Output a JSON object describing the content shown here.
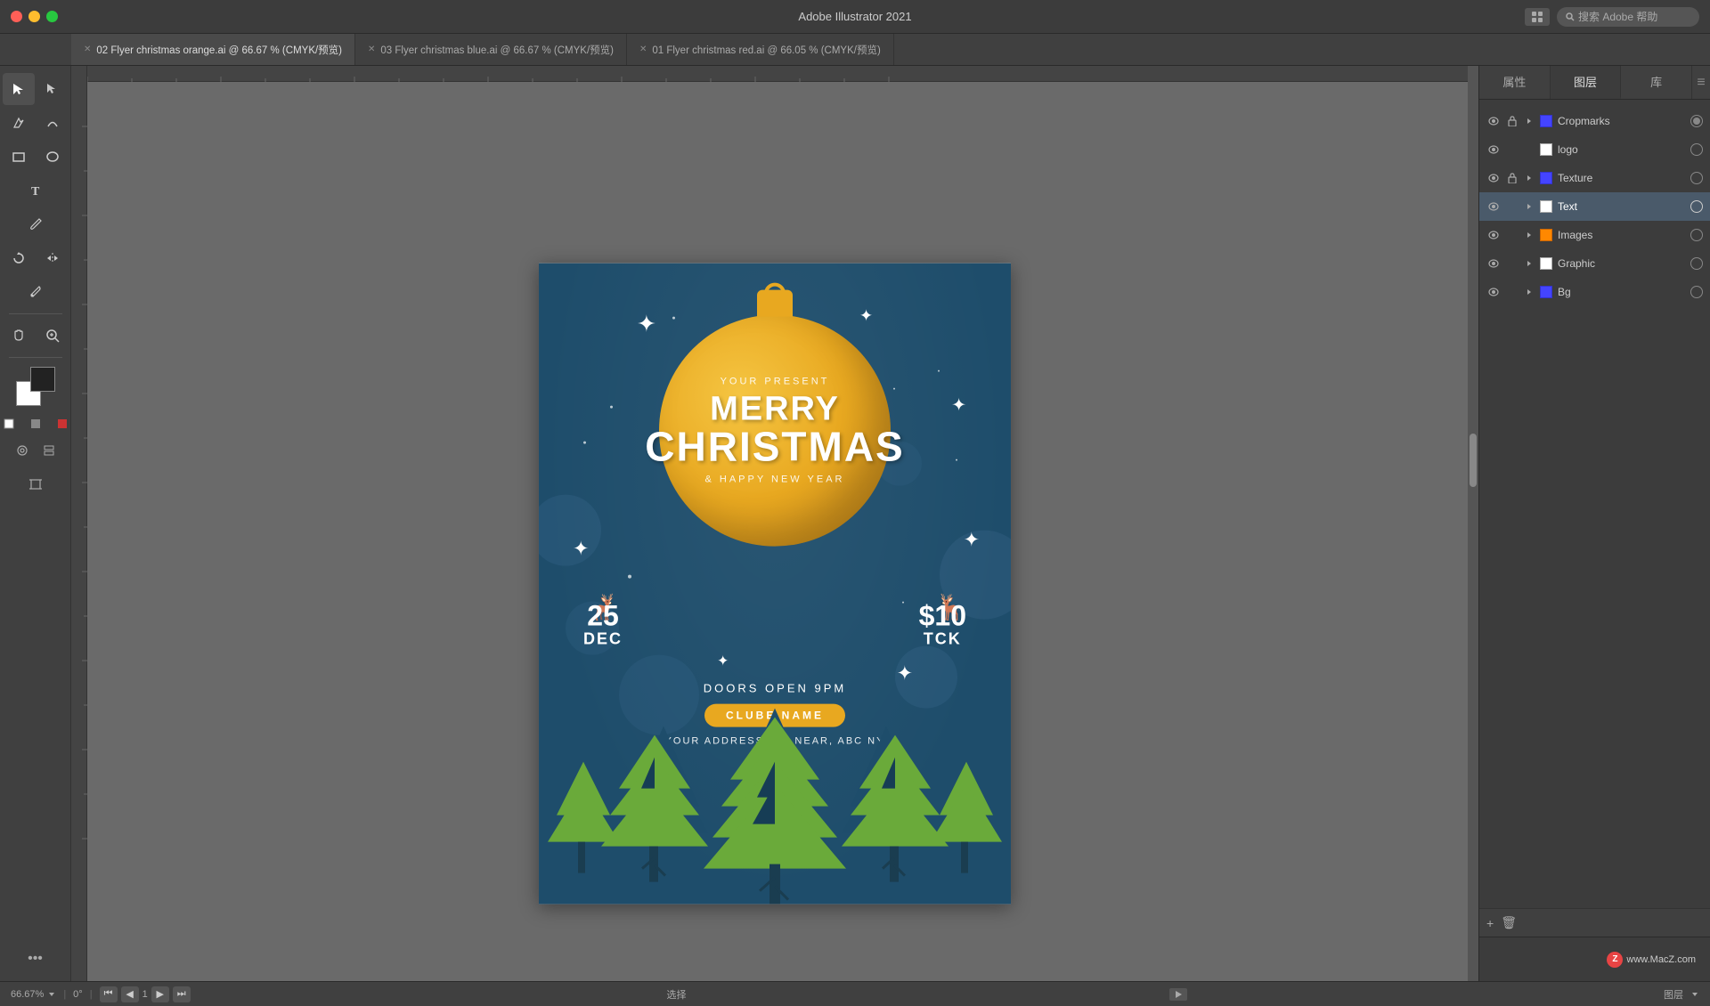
{
  "app": {
    "title": "Adobe Illustrator 2021",
    "search_placeholder": "搜索 Adobe 帮助"
  },
  "tabs": [
    {
      "id": "tab1",
      "label": "02 Flyer christmas orange.ai @ 66.67 % (CMYK/预览)",
      "active": true
    },
    {
      "id": "tab2",
      "label": "03 Flyer christmas blue.ai @ 66.67 % (CMYK/预览)",
      "active": false
    },
    {
      "id": "tab3",
      "label": "01 Flyer christmas red.ai @ 66.05 % (CMYK/预览)",
      "active": false
    }
  ],
  "panel_tabs": [
    {
      "id": "properties",
      "label": "属性",
      "active": false
    },
    {
      "id": "layers",
      "label": "图层",
      "active": true
    },
    {
      "id": "library",
      "label": "库",
      "active": false
    }
  ],
  "layers": [
    {
      "name": "Cropmarks",
      "color": "#5555ff",
      "visible": true,
      "locked": true,
      "expanded": true
    },
    {
      "name": "logo",
      "color": "#ffffff",
      "visible": true,
      "locked": false,
      "expanded": false
    },
    {
      "name": "Texture",
      "color": "#5555ff",
      "visible": true,
      "locked": true,
      "expanded": true
    },
    {
      "name": "Text",
      "color": "#ffffff",
      "visible": true,
      "locked": false,
      "expanded": false
    },
    {
      "name": "Images",
      "color": "#ff8800",
      "visible": true,
      "locked": false,
      "expanded": false
    },
    {
      "name": "Graphic",
      "color": "#ffffff",
      "visible": true,
      "locked": false,
      "expanded": false
    },
    {
      "name": "Bg",
      "color": "#5555ff",
      "visible": true,
      "locked": false,
      "expanded": false
    }
  ],
  "flyer": {
    "present_text": "YOUR PRESENT",
    "merry_text": "MERRY",
    "christmas_text": "CHRISTMAS",
    "happy_text": "& HAPPY NEW YEAR",
    "date_num": "25",
    "date_label": "DEC",
    "price_num": "$10",
    "price_label": "TCK",
    "doors_text": "DOORS OPEN 9PM",
    "club_name": "CLUBE NAME",
    "address_text": "YOUR ADDRESS 123 NEAR, ABC NY"
  },
  "bottom_bar": {
    "zoom": "66.67%",
    "angle": "0°",
    "page": "1",
    "status": "选择",
    "layer_label": "图层"
  },
  "colors": {
    "flyer_bg": "#1e4d6b",
    "ornament": "#e8a820",
    "tree_dark": "#1e4d6b",
    "tree_light": "#6aaa3a",
    "accent": "#e8a820"
  }
}
